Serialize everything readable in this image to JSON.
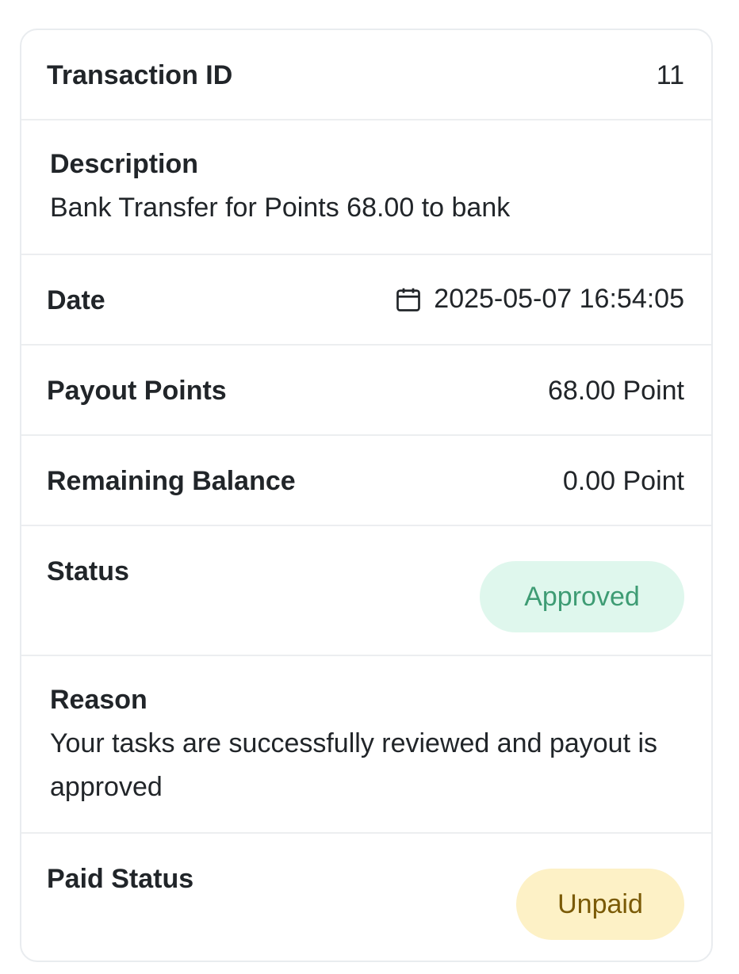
{
  "transaction": {
    "id_label": "Transaction ID",
    "id_value": "11",
    "description_label": "Description",
    "description_value": "Bank Transfer for Points 68.00 to bank",
    "date_label": "Date",
    "date_value": "2025-05-07 16:54:05",
    "date_icon": "calendar-icon",
    "payout_label": "Payout Points",
    "payout_value": "68.00 Point",
    "balance_label": "Remaining Balance",
    "balance_value": "0.00 Point",
    "status_label": "Status",
    "status_value": "Approved",
    "reason_label": "Reason",
    "reason_value": "Your tasks are successfully reviewed and payout is approved",
    "paid_status_label": "Paid Status",
    "paid_status_value": "Unpaid"
  },
  "colors": {
    "approved_bg": "#dff7ed",
    "approved_text": "#3e9c74",
    "unpaid_bg": "#fdf1c6",
    "unpaid_text": "#7a5a06",
    "border": "#e9ecef"
  }
}
